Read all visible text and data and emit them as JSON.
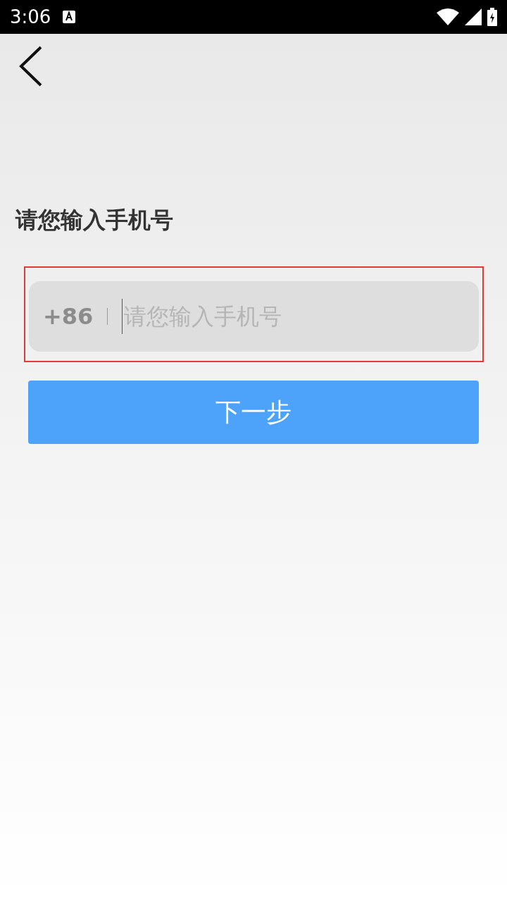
{
  "status_bar": {
    "time": "3:06"
  },
  "title": "请您输入手机号",
  "phone_field": {
    "country_code": "+86",
    "placeholder": "请您输入手机号"
  },
  "next_button": {
    "label": "下一步"
  }
}
